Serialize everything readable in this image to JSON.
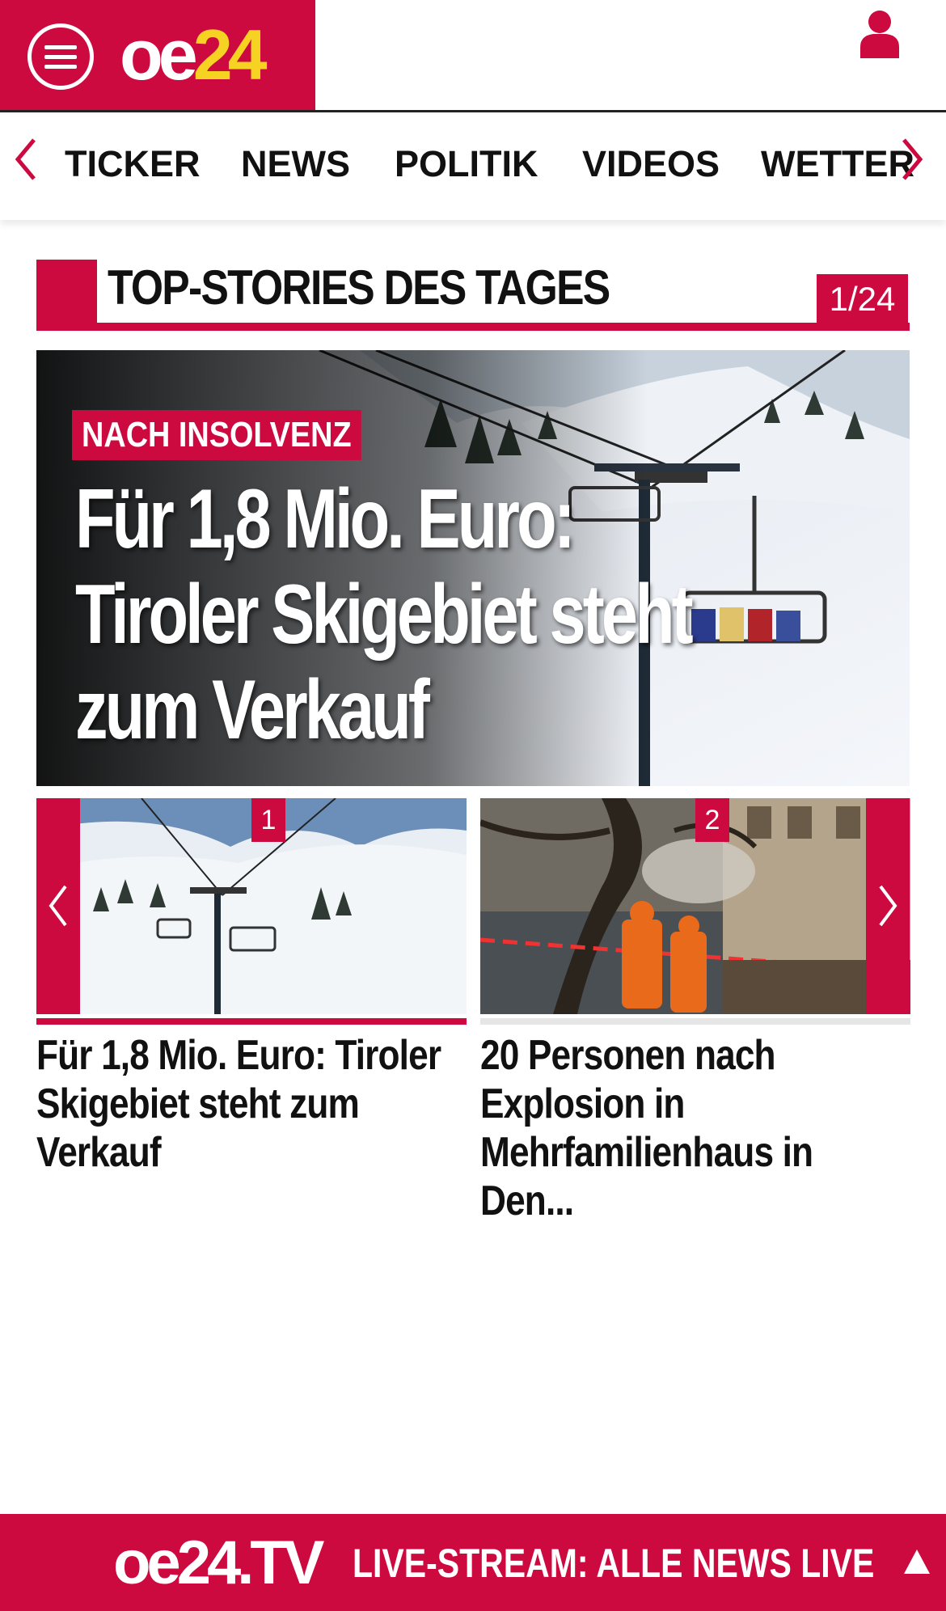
{
  "header": {
    "logo_oe": "oe",
    "logo_num": "24",
    "menu_icon": "hamburger-menu-icon",
    "user_icon": "user-icon",
    "brand_color": "#cc0a3f",
    "logo_accent_color": "#f6d322"
  },
  "nav": {
    "items": [
      "TICKER",
      "NEWS",
      "POLITIK",
      "VIDEOS",
      "WETTER"
    ],
    "left_arrow_icon": "chevron-left-icon",
    "right_arrow_icon": "chevron-right-icon"
  },
  "section": {
    "title": "TOP-STORIES DES TAGES",
    "counter": "1/24"
  },
  "hero": {
    "kicker": "NACH INSOLVENZ",
    "headline": "Für 1,8 Mio. Euro: Tiroler Skigebiet steht zum Verkauf"
  },
  "cards": [
    {
      "badge": "1",
      "title": "Für 1,8 Mio. Euro: Tiroler Skigebiet steht zum Verkauf",
      "active": true
    },
    {
      "badge": "2",
      "title": "20 Personen nach Explosion in Mehrfamilienhaus in Den...",
      "active": false
    }
  ],
  "livebar": {
    "logo": "oe24.TV",
    "text": "LIVE-STREAM:  ALLE NEWS LIVE",
    "up_icon": "arrow-up-icon"
  }
}
